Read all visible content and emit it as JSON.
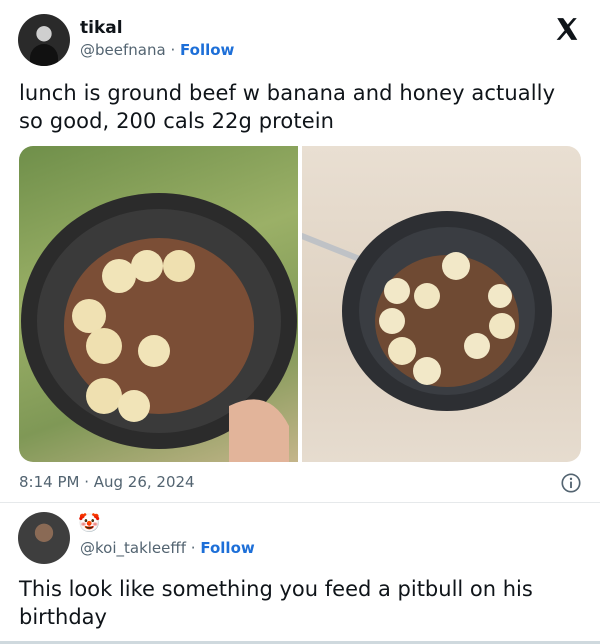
{
  "tweet": {
    "display_name": "tikal",
    "handle": "@beefnana",
    "separator": "·",
    "follow_label": "Follow",
    "text": "lunch is ground beef w banana and honey actually so good, 200 cals 22g protein",
    "timestamp": "8:14 PM · Aug 26, 2024",
    "icons": {
      "logo": "x-logo-icon",
      "info": "info-icon"
    },
    "colors": {
      "follow": "#1d6fd8",
      "secondary_text": "#536471"
    }
  },
  "reply": {
    "emoji": "🤡",
    "handle": "@koi_takleefff",
    "separator": "·",
    "follow_label": "Follow",
    "text": "This look like something you feed a pitbull on his birthday"
  }
}
